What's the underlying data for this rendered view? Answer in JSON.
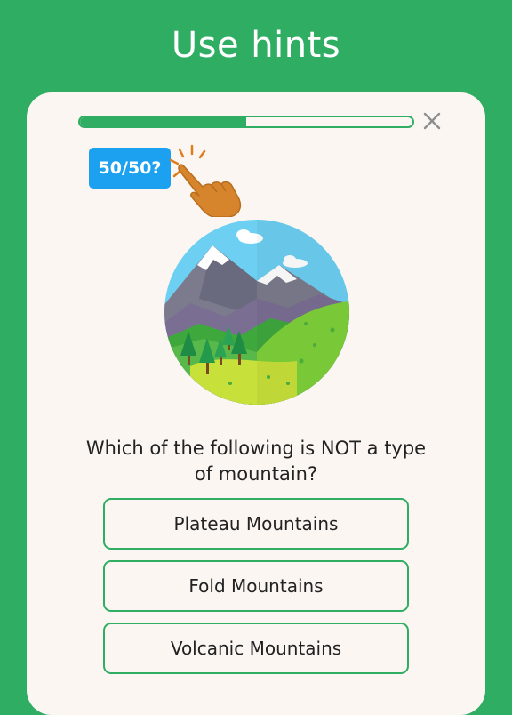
{
  "headline": "Use hints",
  "progress": {
    "fraction": 0.5
  },
  "hint": {
    "label": "50/50?"
  },
  "question": "Which of the following is NOT a type of mountain?",
  "answers": [
    {
      "label": "Plateau Mountains"
    },
    {
      "label": "Fold Mountains"
    },
    {
      "label": "Volcanic Mountains"
    }
  ],
  "icons": [
    "close-icon",
    "tapping-hand-icon",
    "mountain-landscape-image"
  ],
  "colors": {
    "brand": "#2fad62",
    "card": "#fbf6f2",
    "hint": "#1ba1f0",
    "hand": "#d6852c"
  }
}
